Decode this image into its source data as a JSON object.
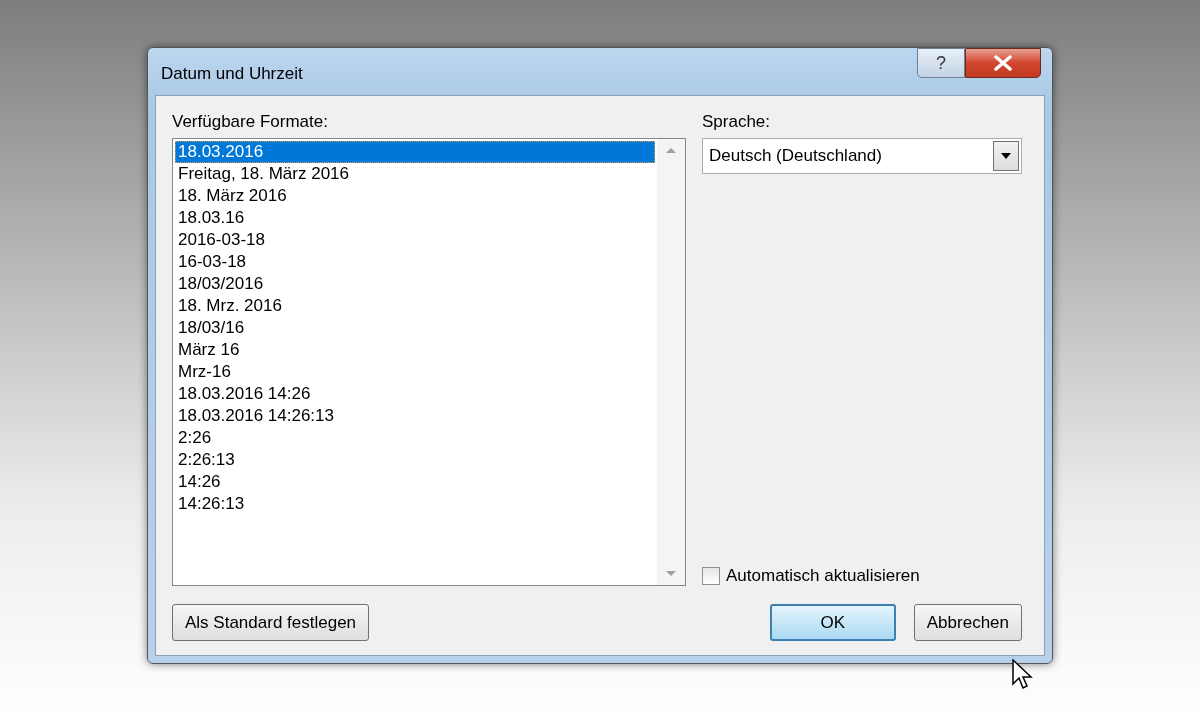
{
  "window": {
    "title": "Datum und Uhrzeit",
    "help": "?"
  },
  "formats": {
    "label": "Verfügbare Formate:",
    "items": [
      {
        "text": "18.03.2016",
        "selected": true
      },
      {
        "text": "Freitag, 18. März 2016",
        "selected": false
      },
      {
        "text": "18. März 2016",
        "selected": false
      },
      {
        "text": "18.03.16",
        "selected": false
      },
      {
        "text": "2016-03-18",
        "selected": false
      },
      {
        "text": "16-03-18",
        "selected": false
      },
      {
        "text": "18/03/2016",
        "selected": false
      },
      {
        "text": "18. Mrz. 2016",
        "selected": false
      },
      {
        "text": "18/03/16",
        "selected": false
      },
      {
        "text": "März 16",
        "selected": false
      },
      {
        "text": "Mrz-16",
        "selected": false
      },
      {
        "text": "18.03.2016 14:26",
        "selected": false
      },
      {
        "text": "18.03.2016 14:26:13",
        "selected": false
      },
      {
        "text": "2:26",
        "selected": false
      },
      {
        "text": "2:26:13",
        "selected": false
      },
      {
        "text": "14:26",
        "selected": false
      },
      {
        "text": "14:26:13",
        "selected": false
      }
    ]
  },
  "language": {
    "label": "Sprache:",
    "value": "Deutsch (Deutschland)"
  },
  "auto_update": {
    "label": "Automatisch aktualisieren",
    "checked": false
  },
  "buttons": [
    {
      "label": "Als Standard festlegen",
      "kind": "normal"
    },
    {
      "label": "OK",
      "kind": "default"
    },
    {
      "label": "Abbrechen",
      "kind": "normal"
    }
  ]
}
